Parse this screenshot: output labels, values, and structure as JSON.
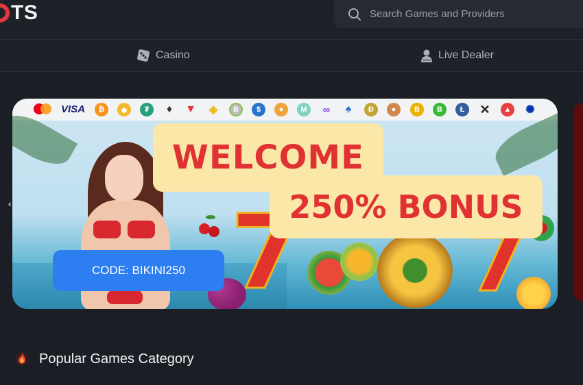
{
  "header": {
    "logo_text": "TS",
    "search_placeholder": "Search Games and Providers"
  },
  "nav": {
    "items": [
      {
        "label": "Casino",
        "icon": "dice-icon"
      },
      {
        "label": "Live Dealer",
        "icon": "dealer-icon"
      }
    ]
  },
  "banner": {
    "payment_methods": [
      "mastercard",
      "VISA",
      "bitcoin",
      "binance-coin",
      "tether",
      "ethereum",
      "tron",
      "binance-usd",
      "bitcoin-cash",
      "usd-coin",
      "shiba-inu",
      "polygon",
      "polygon-matic",
      "chia",
      "dogecoin",
      "pancakeswap",
      "bitcoin-sv",
      "bitcoin-gold",
      "litecoin",
      "xrp",
      "avalanche",
      "cardano"
    ],
    "visa_label": "VISA",
    "welcome": "WELCOME",
    "bonus": "250% BONUS",
    "code_button": "CODE: BIKINI250"
  },
  "section": {
    "title": "Popular Games Category",
    "icon": "fire-icon"
  },
  "colors": {
    "background": "#1c1e26",
    "accent_blue": "#2d7ef0",
    "banner_red": "#e03232",
    "banner_cream": "#fbe8a8"
  }
}
